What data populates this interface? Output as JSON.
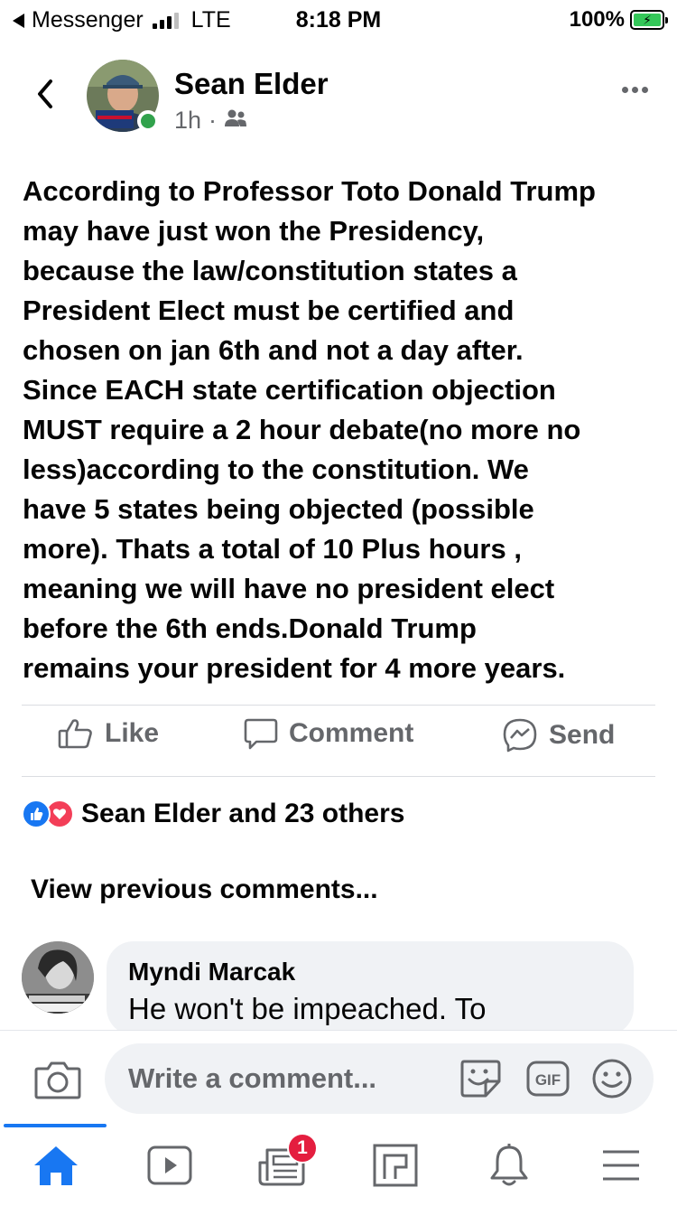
{
  "status_bar": {
    "carrier": "Messenger",
    "network": "LTE",
    "time": "8:18 PM",
    "battery": "100%"
  },
  "post": {
    "author": "Sean Elder",
    "time": "1h",
    "separator": "·",
    "audience_icon": "friends-icon",
    "text": "According to Professor Toto Donald Trump\nmay have just won the Presidency,\nbecause the law/constitution  states a\nPresident Elect must be certified and\nchosen on jan 6th and not a day after.\nSince EACH state certification objection\nMUST require a 2 hour debate(no more no\nless)according to the constitution. We\nhave 5 states being objected (possible\nmore). Thats a total of 10 Plus hours ,\nmeaning we will have no president elect\nbefore the 6th ends.Donald  Trump\nremains your president for 4 more years."
  },
  "actions": {
    "like": "Like",
    "comment": "Comment",
    "send": "Send"
  },
  "reactions": {
    "summary": "Sean Elder and 23 others"
  },
  "comments": {
    "view_previous": "View previous comments...",
    "items": [
      {
        "author": "Myndi Marcak",
        "text": "He won't be impeached. To"
      }
    ]
  },
  "composer": {
    "placeholder": "Write a comment...",
    "gif_label": "GIF"
  },
  "tab_bar": {
    "notifications_badge": "1"
  },
  "colors": {
    "accent": "#1877f2",
    "online": "#31a24c",
    "love": "#f33e58",
    "badge": "#e41e3f",
    "muted": "#65676b"
  }
}
